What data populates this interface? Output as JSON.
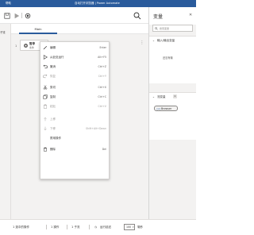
{
  "titlebar": {
    "help_label": "帮助",
    "title": "自动打开浏览器 | Power Automate"
  },
  "flow_panel": {
    "label": "子流"
  },
  "tabs": [
    {
      "label": "Main"
    }
  ],
  "canvas": {
    "line_number": "1",
    "action": {
      "title": "暂停",
      "subtitle": "条件",
      "icon": "gear-icon"
    }
  },
  "context_menu": {
    "items": [
      {
        "label": "编辑",
        "shortcut": "Enter",
        "icon": "pencil-icon",
        "enabled": true
      },
      {
        "label": "从此处运行",
        "shortcut": "Alt+F5",
        "icon": "play-icon",
        "enabled": true
      },
      {
        "label": "撤消",
        "shortcut": "Ctrl+Z",
        "icon": "undo-icon",
        "enabled": true
      },
      {
        "label": "恢复",
        "shortcut": "Ctrl+Y",
        "icon": "redo-icon",
        "enabled": false
      },
      {
        "label": "剪切",
        "shortcut": "Ctrl+X",
        "icon": "scissors-icon",
        "enabled": true
      },
      {
        "label": "复制",
        "shortcut": "Ctrl+C",
        "icon": "copy-icon",
        "enabled": true
      },
      {
        "label": "粘贴",
        "shortcut": "Ctrl+V",
        "icon": "paste-icon",
        "enabled": false
      },
      {
        "label": "上移",
        "shortcut": "",
        "icon": "arrow-up-icon",
        "enabled": false
      },
      {
        "label": "下移",
        "shortcut": "Shift+Alt+Down",
        "icon": "arrow-down-icon",
        "enabled": false
      },
      {
        "label": "禁用操作",
        "shortcut": "",
        "icon": "",
        "enabled": true
      },
      {
        "label": "删除",
        "shortcut": "Del",
        "icon": "trash-icon",
        "enabled": true
      }
    ]
  },
  "variables_pane": {
    "title": "变量",
    "search_placeholder": "搜索变量",
    "io_section": {
      "label": "输入/输出变量",
      "empty_text": "还没有输"
    },
    "flow_section": {
      "label": "流变量",
      "count": "1",
      "variables": [
        {
          "name": "Browser"
        }
      ]
    }
  },
  "statusbar": {
    "selected": "1 选中的操作",
    "actions": "1 操作",
    "subflows": "1 子流",
    "delay_label": "运行延迟",
    "delay_value": "100",
    "delay_unit": "毫秒"
  },
  "colors": {
    "titlebar": "#2a5b9c",
    "canvas_bg": "#f3f2f1",
    "accent": "#2a5b9c"
  }
}
